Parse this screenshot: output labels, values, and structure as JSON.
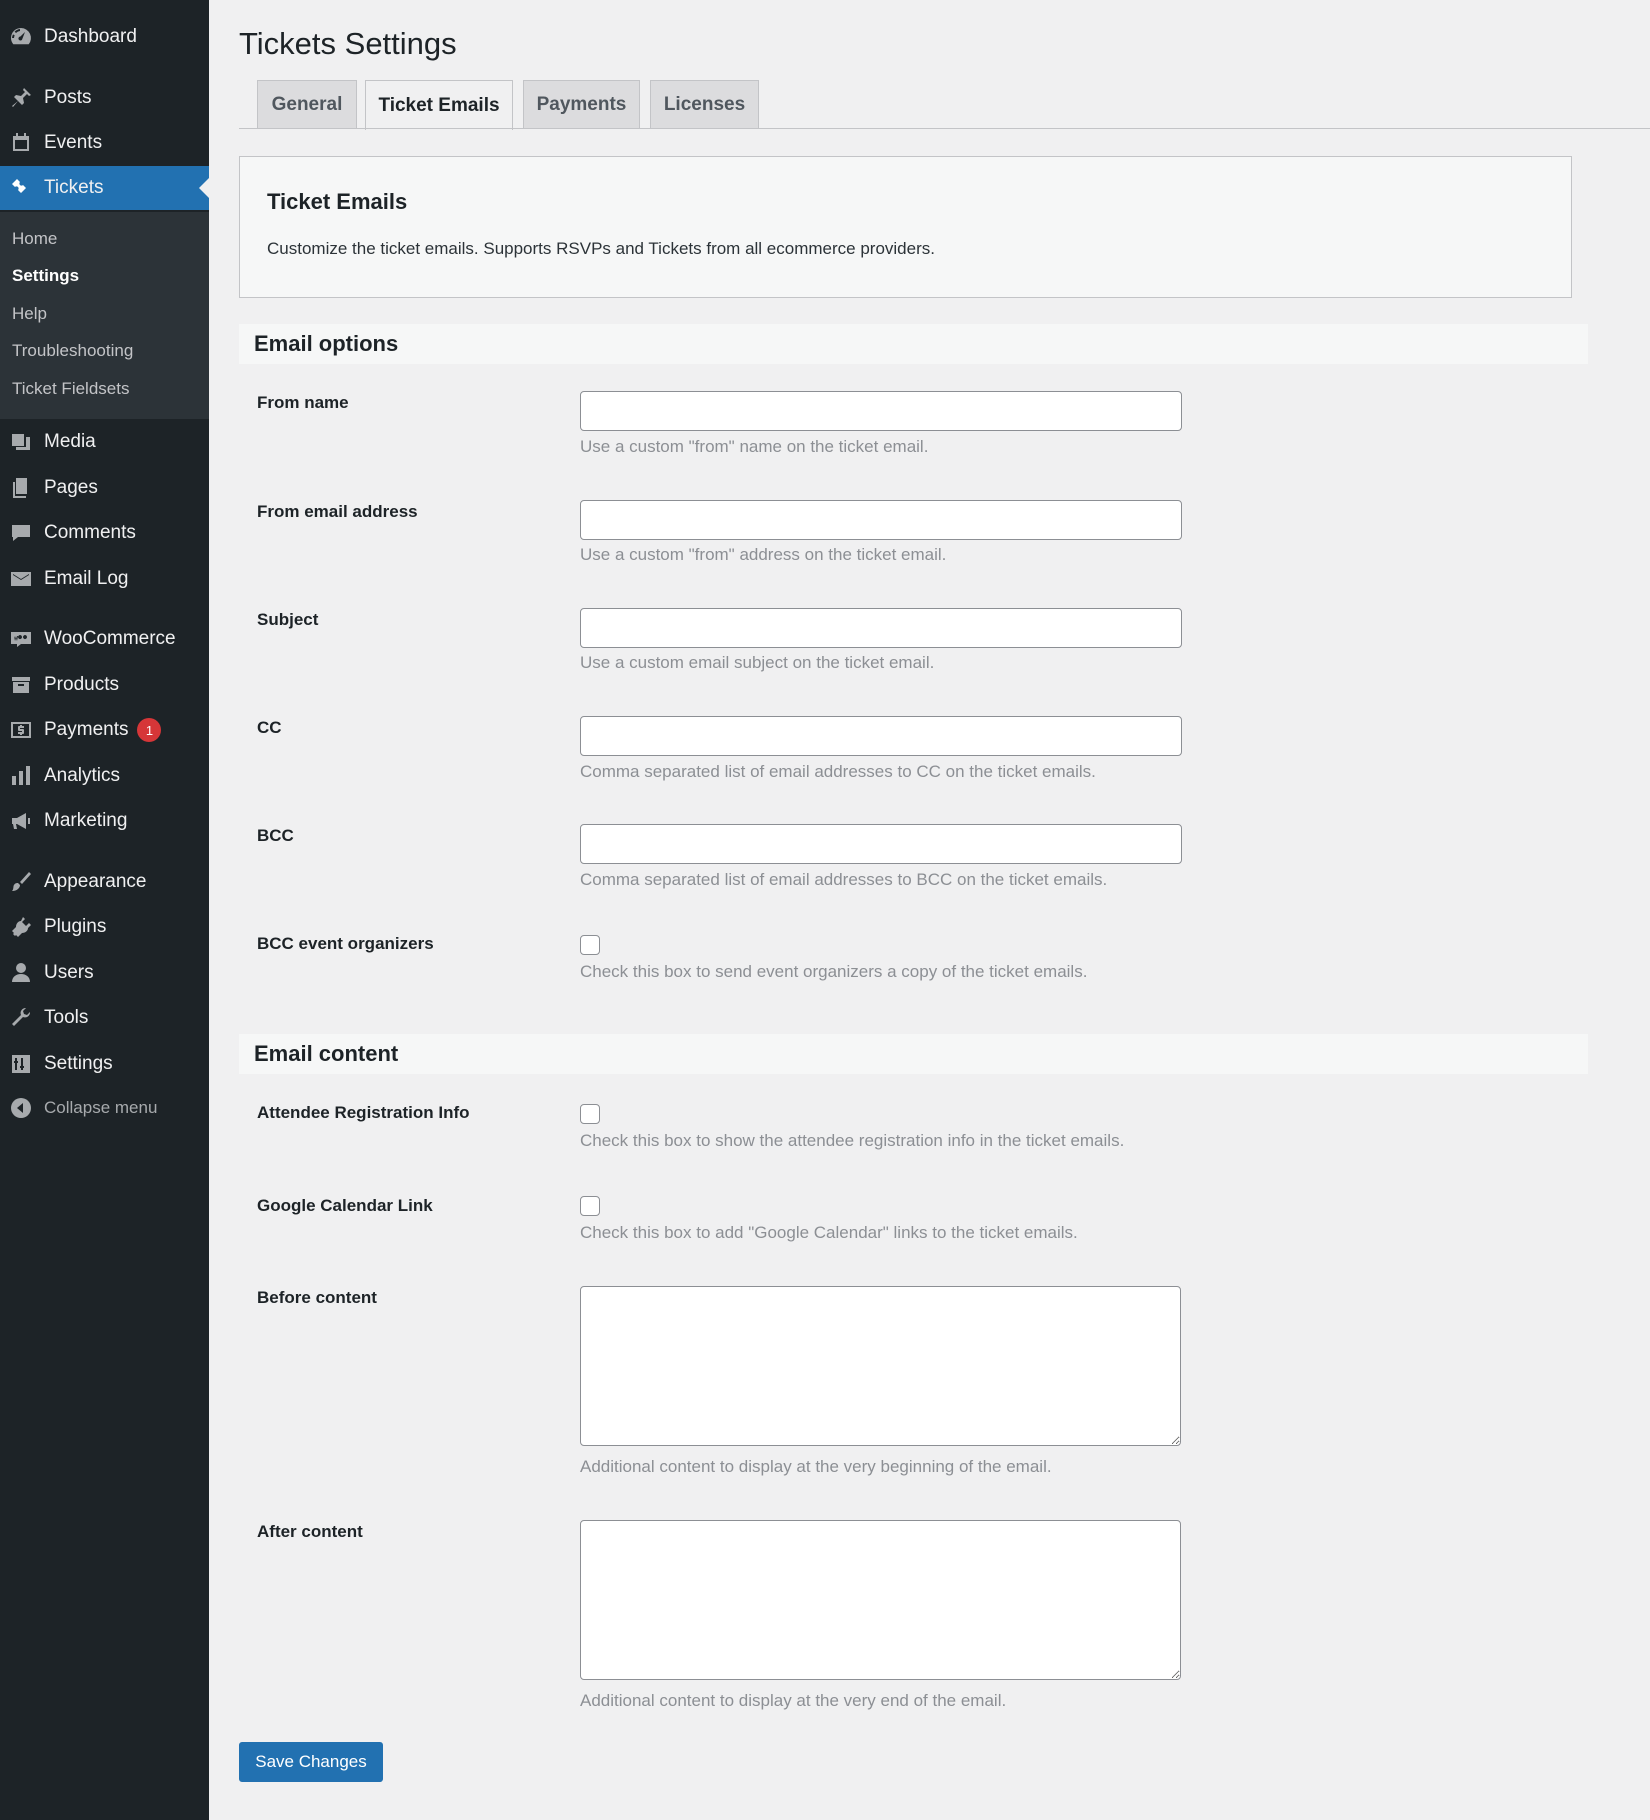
{
  "sidebar": {
    "items": [
      {
        "label": "Dashboard",
        "icon": "dashboard-icon"
      },
      {
        "label": "Posts",
        "icon": "pin-icon"
      },
      {
        "label": "Events",
        "icon": "calendar-icon"
      },
      {
        "label": "Tickets",
        "icon": "ticket-icon"
      },
      {
        "label": "Media",
        "icon": "media-icon"
      },
      {
        "label": "Pages",
        "icon": "pages-icon"
      },
      {
        "label": "Comments",
        "icon": "comment-icon"
      },
      {
        "label": "Email Log",
        "icon": "email-icon"
      },
      {
        "label": "WooCommerce",
        "icon": "woo-icon"
      },
      {
        "label": "Products",
        "icon": "archive-icon"
      },
      {
        "label": "Payments",
        "icon": "dollar-icon",
        "badge": "1"
      },
      {
        "label": "Analytics",
        "icon": "chart-bar-icon"
      },
      {
        "label": "Marketing",
        "icon": "megaphone-icon"
      },
      {
        "label": "Appearance",
        "icon": "brush-icon"
      },
      {
        "label": "Plugins",
        "icon": "plugin-icon"
      },
      {
        "label": "Users",
        "icon": "user-icon"
      },
      {
        "label": "Tools",
        "icon": "wrench-icon"
      },
      {
        "label": "Settings",
        "icon": "settings-icon"
      }
    ],
    "submenu": [
      "Home",
      "Settings",
      "Help",
      "Troubleshooting",
      "Ticket Fieldsets"
    ],
    "collapse_label": "Collapse menu",
    "accent": "#2271b1",
    "badge_color": "#d63638"
  },
  "page": {
    "title": "Tickets Settings",
    "tabs": [
      "General",
      "Ticket Emails",
      "Payments",
      "Licenses"
    ],
    "active_tab": "Ticket Emails"
  },
  "intro": {
    "title": "Ticket Emails",
    "description": "Customize the ticket emails. Supports RSVPs and Tickets from all ecommerce providers."
  },
  "email_options": {
    "heading": "Email options",
    "fields": [
      {
        "label": "From name",
        "value": "",
        "desc": "Use a custom \"from\" name on the ticket email."
      },
      {
        "label": "From email address",
        "value": "",
        "desc": "Use a custom \"from\" address on the ticket email."
      },
      {
        "label": "Subject",
        "value": "",
        "desc": "Use a custom email subject on the ticket email."
      },
      {
        "label": "CC",
        "value": "",
        "desc": "Comma separated list of email addresses to CC on the ticket emails."
      },
      {
        "label": "BCC",
        "value": "",
        "desc": "Comma separated list of email addresses to BCC on the ticket emails."
      }
    ],
    "bcc_organizers": {
      "label": "BCC event organizers",
      "checked": false,
      "desc": "Check this box to send event organizers a copy of the ticket emails."
    }
  },
  "email_content": {
    "heading": "Email content",
    "attendee_info": {
      "label": "Attendee Registration Info",
      "checked": false,
      "desc": "Check this box to show the attendee registration info in the ticket emails."
    },
    "google_calendar": {
      "label": "Google Calendar Link",
      "checked": false,
      "desc": "Check this box to add \"Google Calendar\" links to the ticket emails."
    },
    "before_content": {
      "label": "Before content",
      "value": "",
      "desc": "Additional content to display at the very beginning of the email."
    },
    "after_content": {
      "label": "After content",
      "value": "",
      "desc": "Additional content to display at the very end of the email."
    }
  },
  "save_label": "Save Changes"
}
